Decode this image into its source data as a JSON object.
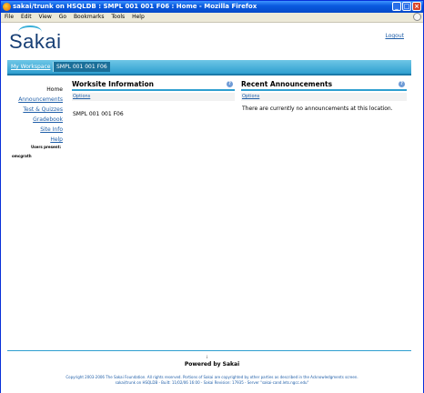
{
  "window": {
    "title": "sakai/trunk on HSQLDB : SMPL 001 001 F06 : Home - Mozilla Firefox",
    "minimize": "_",
    "maximize": "□",
    "close": "×"
  },
  "menubar": [
    "File",
    "Edit",
    "View",
    "Go",
    "Bookmarks",
    "Tools",
    "Help"
  ],
  "header": {
    "logo": "Sakai",
    "logout": "Logout"
  },
  "sites": {
    "workspace": "My Workspace",
    "current": "SMPL 001 001 F06"
  },
  "toolnav": {
    "current": "Home",
    "items": [
      "Announcements",
      "Test & Quizzes",
      "Gradebook",
      "Site Info",
      "Help"
    ]
  },
  "presence": {
    "label": "Users present:",
    "user": "omcgrath"
  },
  "worksite": {
    "title": "Worksite Information",
    "options": "Options",
    "body": "SMPL 001 001 F06",
    "help_icon": "?"
  },
  "announcements": {
    "title": "Recent Announcements",
    "options": "Options",
    "body": "There are currently no announcements at this location.",
    "help_icon": "?"
  },
  "footer": {
    "separator": "i",
    "powered": "Powered by Sakai",
    "copyright": "Copyright 2003-2006 The Sakai Foundation. All rights reserved. Portions of Sakai are copyrighted by other parties as described in the Acknowledgments screen.",
    "build": "sakai/trunk on HSQLDB - Built: 11/02/06 16:00 - Sakai Revision: 17935 - Server \"sakai-cand.lets.ngcc.edu\""
  }
}
